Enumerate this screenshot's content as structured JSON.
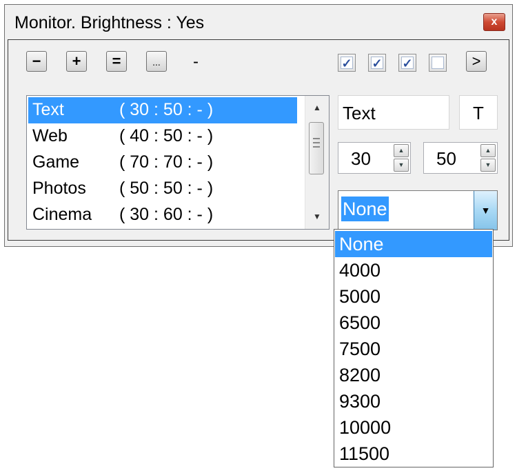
{
  "window": {
    "title": "Monitor. Brightness : Yes",
    "close_label": "x"
  },
  "toolbar": {
    "minus_label": "−",
    "plus_label": "+",
    "equals_label": "=",
    "more_label": "...",
    "status": "-",
    "next_label": ">"
  },
  "checkboxes": [
    {
      "checked": true,
      "mark": "✓"
    },
    {
      "checked": true,
      "mark": "✓"
    },
    {
      "checked": true,
      "mark": "✓"
    },
    {
      "checked": false,
      "mark": ""
    }
  ],
  "presets": [
    {
      "name": "Text",
      "values": "( 30 : 50 : - )",
      "selected": true
    },
    {
      "name": "Web",
      "values": "( 40 : 50 : - )",
      "selected": false
    },
    {
      "name": "Game",
      "values": "( 70 : 70 : - )",
      "selected": false
    },
    {
      "name": "Photos",
      "values": "( 50 : 50 : - )",
      "selected": false
    },
    {
      "name": "Cinema",
      "values": "( 30 : 60 : - )",
      "selected": false
    }
  ],
  "name_field": {
    "value": "Text"
  },
  "hotkey_field": {
    "value": "T"
  },
  "brightness": {
    "value": "30"
  },
  "contrast": {
    "value": "50"
  },
  "color_temp": {
    "selected": "None",
    "options": [
      "None",
      "4000",
      "5000",
      "6500",
      "7500",
      "8200",
      "9300",
      "10000",
      "11500"
    ]
  }
}
